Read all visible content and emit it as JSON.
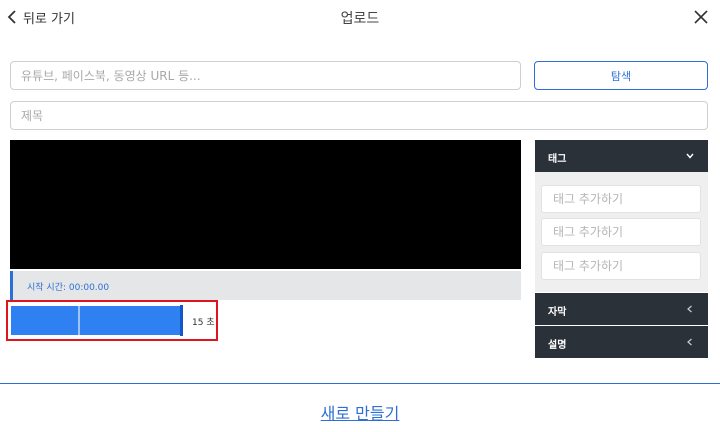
{
  "header": {
    "back_label": "뒤로 가기",
    "title": "업로드"
  },
  "source": {
    "url_placeholder": "유튜브, 페이스북, 동영상 URL 등...",
    "url_value": "",
    "search_label": "탐색",
    "title_placeholder": "제목",
    "title_value": ""
  },
  "player": {
    "start_time_label": "시작 시간: 00:00.00",
    "duration_label": "15 초"
  },
  "side_panel": {
    "tags": {
      "header": "태그",
      "input_placeholders": [
        "태그 추가하기",
        "태그 추가하기",
        "태그 추가하기"
      ]
    },
    "subtitles": {
      "header": "자막"
    },
    "description": {
      "header": "설명"
    }
  },
  "footer": {
    "create_label": "새로 만들기"
  },
  "colors": {
    "accent": "#2d6fd6",
    "timeline": "#2f80f0",
    "panel_header": "#2b3138",
    "highlight_outline": "#e0141e"
  },
  "icons": {
    "back": "chevron-left-icon",
    "close": "close-icon",
    "tags_toggle": "chevron-down-icon",
    "subtitles_toggle": "chevron-left-icon",
    "description_toggle": "chevron-left-icon"
  }
}
